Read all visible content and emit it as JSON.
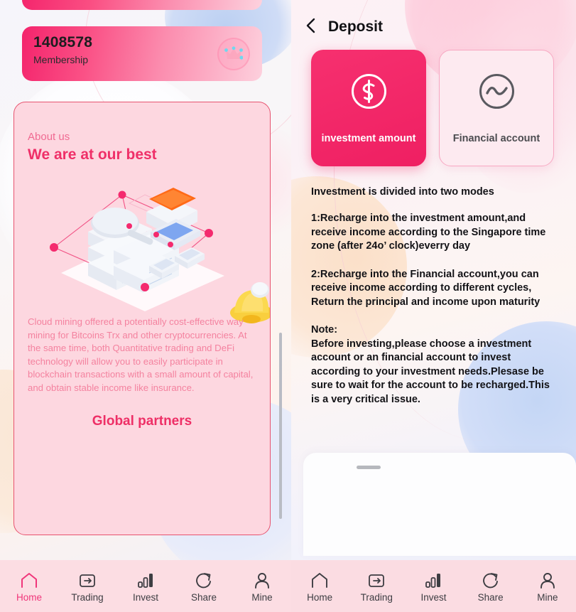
{
  "left_panel": {
    "membership_card": {
      "number": "1408578",
      "label": "Membership",
      "icon": "crown-icon"
    },
    "about_card": {
      "kicker": "About us",
      "title": "We are at our best",
      "illustration_icon": "isometric-servers-illustration",
      "bell_icon": "bell-icon",
      "body": "Cloud mining offered a potentially cost-effective way mining for Bitcoins Trx and other cryptocurrencies. At the same time, both Quantitative trading and DeFi technology will allow you to easily participate in blockchain transactions with a small amount of capital, and obtain stable income like insurance.",
      "partners_title": "Global partners"
    },
    "navbar": {
      "items": [
        {
          "label": "Home",
          "icon": "home-icon",
          "active": true
        },
        {
          "label": "Trading",
          "icon": "wallet-icon",
          "active": false
        },
        {
          "label": "Invest",
          "icon": "bars-icon",
          "active": false
        },
        {
          "label": "Share",
          "icon": "share-icon",
          "active": false
        },
        {
          "label": "Mine",
          "icon": "person-icon",
          "active": false
        }
      ]
    }
  },
  "right_panel": {
    "header": {
      "back_icon": "chevron-left-icon",
      "title": "Deposit"
    },
    "mode_cards": [
      {
        "label": "investment amount",
        "icon": "dollar-circle-icon",
        "active": true
      },
      {
        "label": "Financial account",
        "icon": "wave-circle-icon",
        "active": false
      }
    ],
    "content": {
      "lead": "Investment is divided into two modes",
      "item1": "1:Recharge into the investment amount,and receive income according to the Singapore time zone (after 24o’ clock)everry day",
      "item2": "2:Recharge into the Financial account,you can receive income according to different cycles, Return the principal and income upon maturity",
      "note_head": "Note:",
      "note_body": "Before investing,please choose a investment account or an financial account to invest according to your investment needs.Plesase be sure to wait for the account to be recharged.This is a very critical issue."
    },
    "sheet": {
      "handle_icon": "drag-handle-icon"
    },
    "navbar": {
      "items": [
        {
          "label": "Home",
          "icon": "home-icon",
          "active": false
        },
        {
          "label": "Trading",
          "icon": "wallet-icon",
          "active": false
        },
        {
          "label": "Invest",
          "icon": "bars-icon",
          "active": false
        },
        {
          "label": "Share",
          "icon": "share-icon",
          "active": false
        },
        {
          "label": "Mine",
          "icon": "person-icon",
          "active": false
        }
      ]
    }
  },
  "colors": {
    "accent_pink": "#ef2f68",
    "card_pink": "#fdd7e0",
    "nav_bg": "#fcdde3",
    "active_card": "#f6306f"
  }
}
